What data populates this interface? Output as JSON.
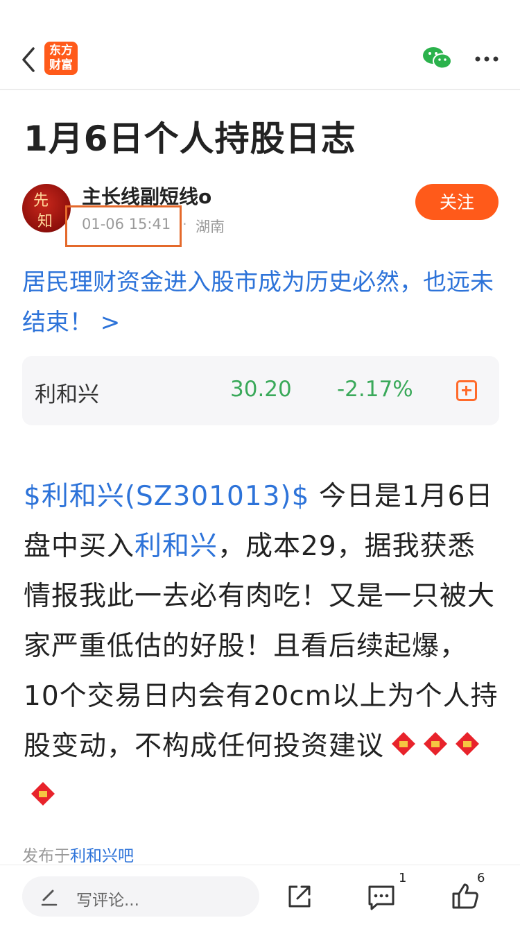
{
  "header": {
    "back_icon": "chevron-left-icon",
    "logo_text": "东方财富",
    "share_wechat_icon": "wechat-icon",
    "more_icon": "more-horizontal-icon"
  },
  "article": {
    "title": "1月6日个人持股日志",
    "author": {
      "name": "主长线副短线o",
      "avatar_text": "先知",
      "time": "01-06 15:41",
      "location": "湖南",
      "follow_label": "关注"
    },
    "headline_link": "居民理财资金进入股市成为历史必然，也远未结束！ >",
    "stock": {
      "name": "利和兴",
      "price": "30.20",
      "change": "-2.17%"
    },
    "body": {
      "tag": "$利和兴(SZ301013)$",
      "part1": "  今日是1月6日盘中买入",
      "stock_link": "利和兴",
      "part2": "，成本29，据我获悉情报我此一去必有肉吃！又是一只被大家严重低估的好股！且看后续起爆，10个交易日内会有20cm以上为个人持股变动，不构成任何投资建议"
    },
    "posted_prefix": "发布于",
    "posted_forum": "利和兴吧"
  },
  "bottombar": {
    "comment_placeholder": "写评论...",
    "comment_count": "1",
    "like_count": "6"
  },
  "colors": {
    "accent": "#ff5a1a",
    "link": "#2d73d9",
    "down_green": "#3aa95a",
    "highlight_box": "#e4692b"
  }
}
